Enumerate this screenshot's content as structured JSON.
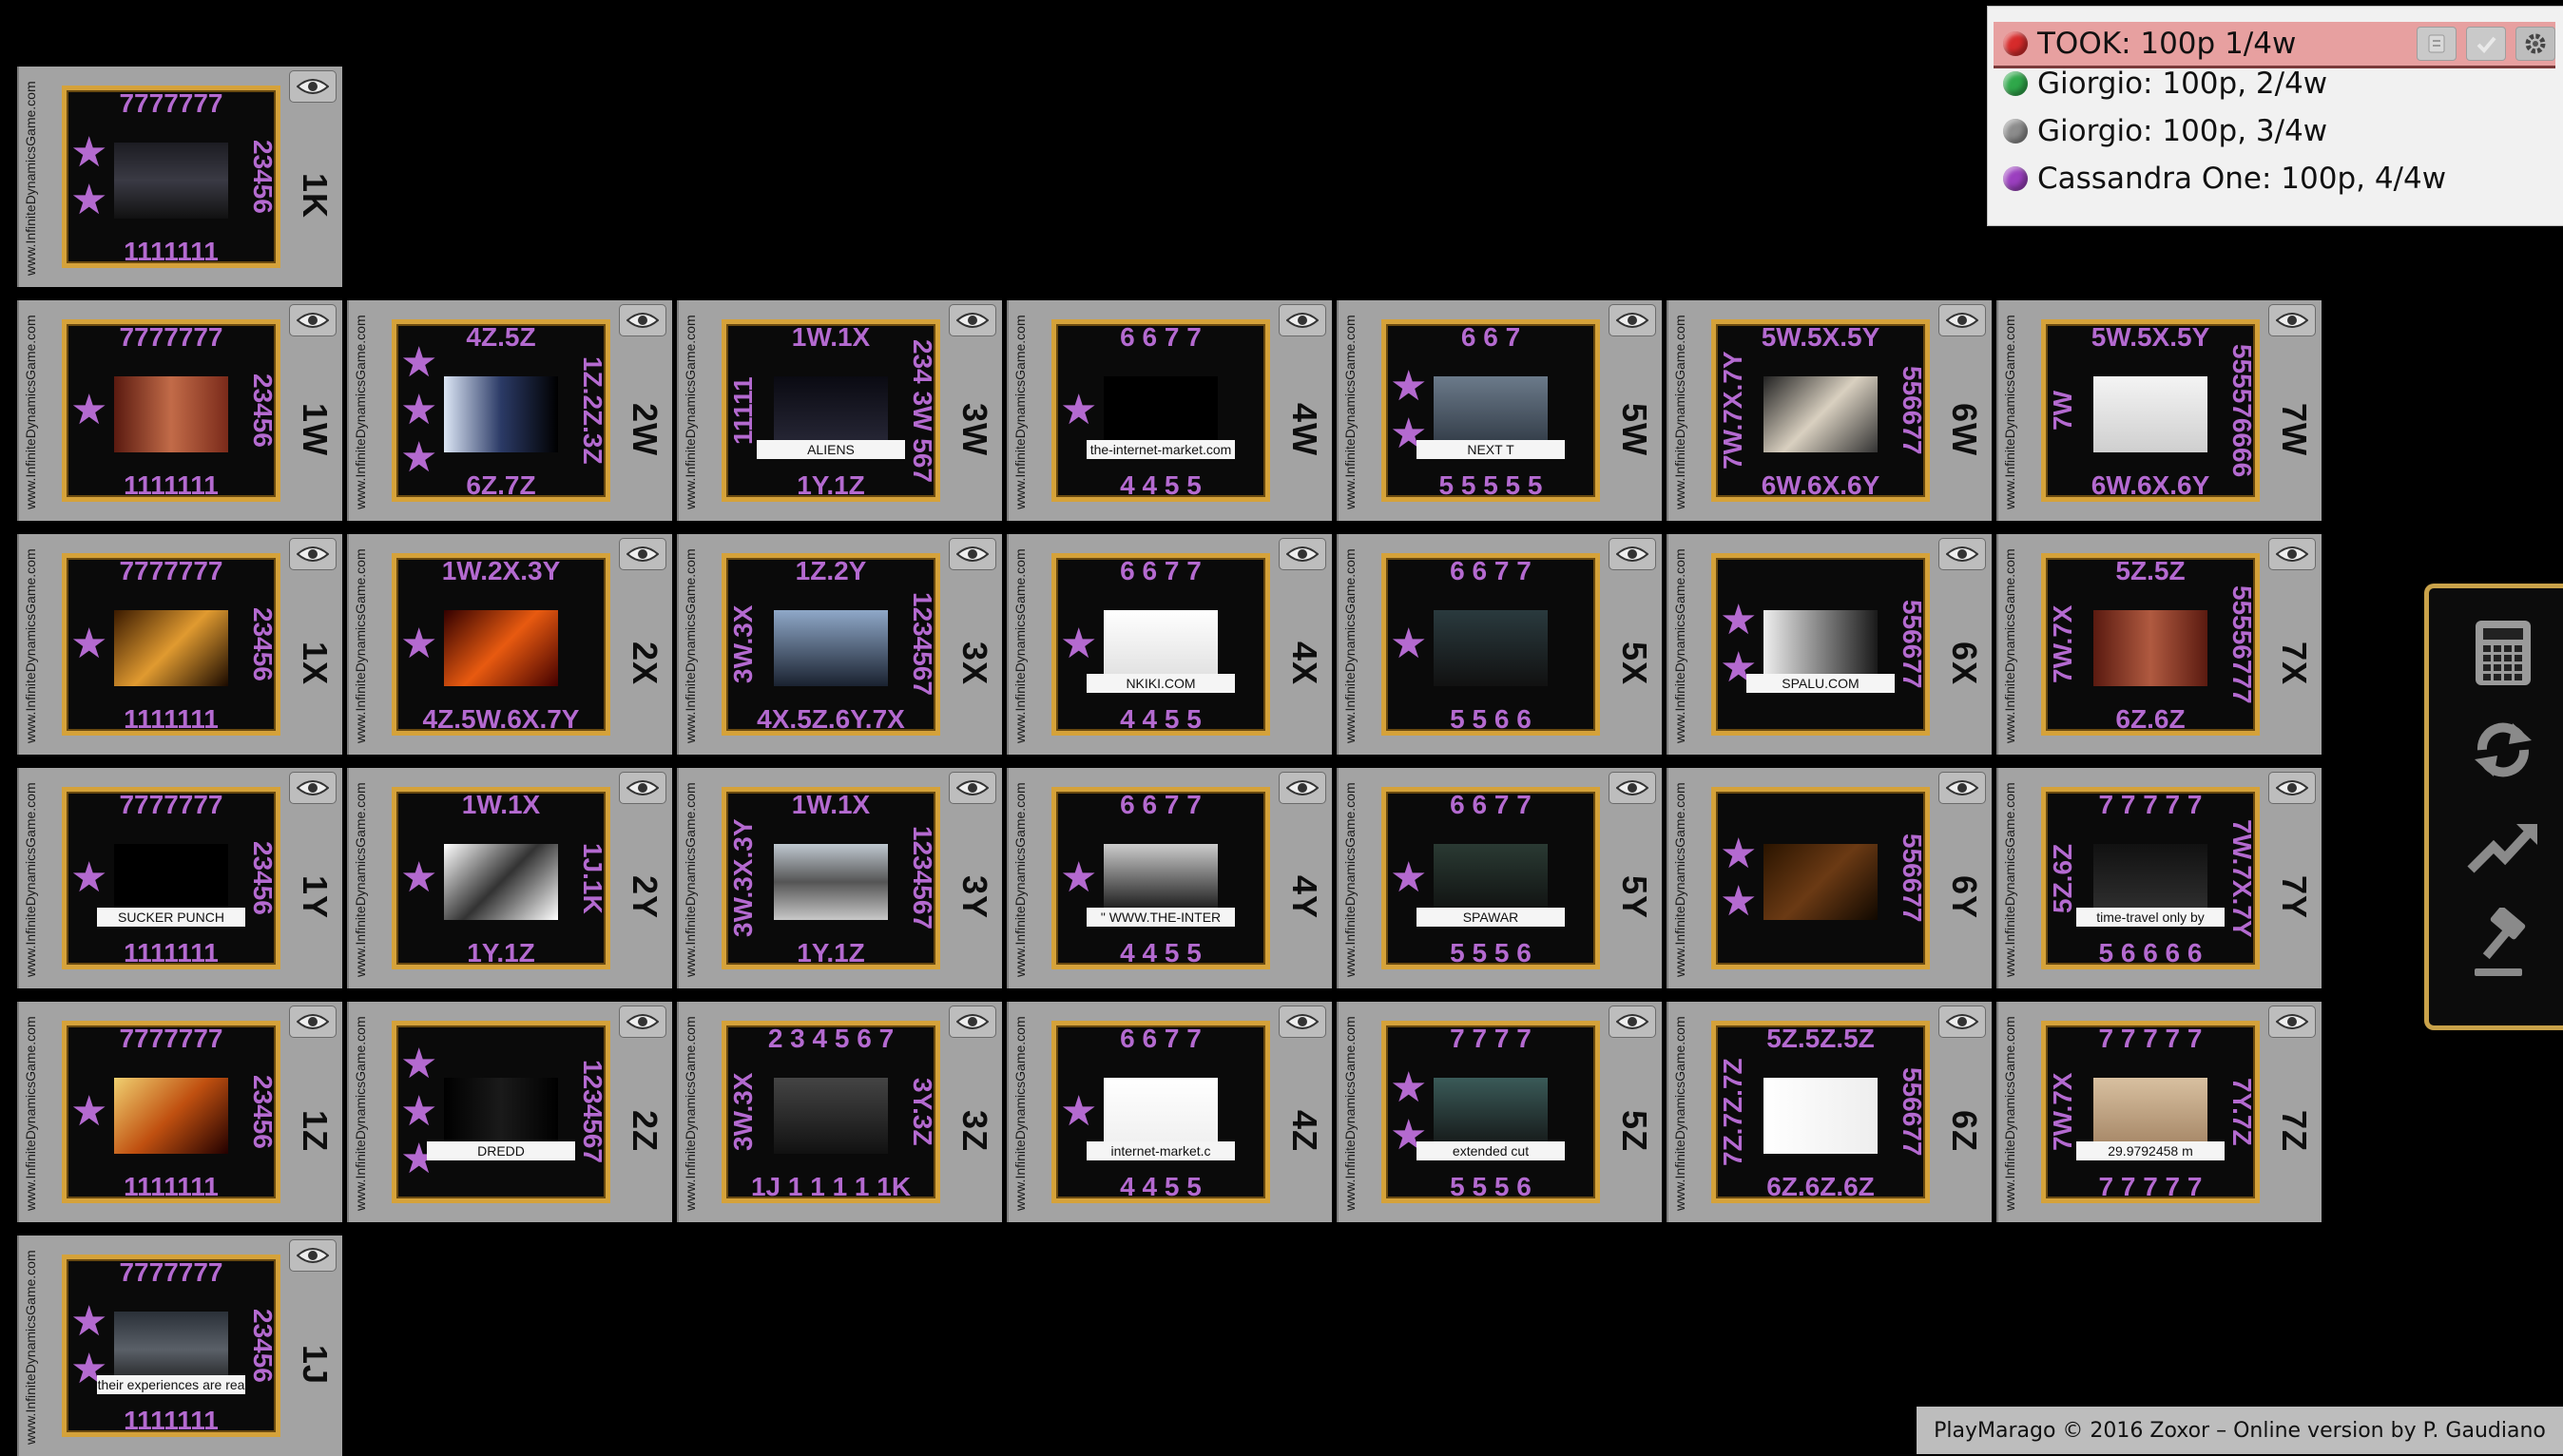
{
  "players": [
    {
      "label": "TOOK: 100p 1/4w",
      "color": "#d62b2b",
      "active": true
    },
    {
      "label": "Giorgio: 100p, 2/4w",
      "color": "#2fa84a",
      "active": false
    },
    {
      "label": "Giorgio: 100p, 3/4w",
      "color": "#8c8c8c",
      "active": false
    },
    {
      "label": "Cassandra One: 100p, 4/4w",
      "color": "#9b3fbf",
      "active": false
    }
  ],
  "player_buttons": [
    "list-icon",
    "check-icon",
    "gear-icon"
  ],
  "website": "www.InfiniteDynamicsGame.com",
  "cards": {
    "r0c0": {
      "code": "1K",
      "top": "7777777",
      "bottom": "1111111",
      "right": "23456",
      "left": "",
      "stars": 2
    },
    "r1c0": {
      "code": "1W",
      "top": "7777777",
      "bottom": "1111111",
      "right": "23456",
      "left": "",
      "stars": 1
    },
    "r1c1": {
      "code": "2W",
      "top": "4Z.5Z",
      "bottom": "6Z.7Z",
      "right": "1Z.2Z.3Z",
      "left": "",
      "stars": 3
    },
    "r1c2": {
      "code": "3W",
      "top": "1W.1X",
      "bottom": "1Y.1Z",
      "right": "234 3W 567",
      "left": "11111",
      "stars": 0,
      "text": "ALIENS"
    },
    "r1c3": {
      "code": "4W",
      "top": "6 6 7 7",
      "bottom": "4 4 5 5",
      "right": "",
      "left": "",
      "stars": 1,
      "text": "the-internet-market.com"
    },
    "r1c4": {
      "code": "5W",
      "top": "6 6 7",
      "bottom": "5 5 5 5 5",
      "right": "",
      "left": "",
      "stars": 2,
      "text": "NEXT T"
    },
    "r1c5": {
      "code": "6W",
      "top": "5W.5X.5Y",
      "bottom": "6W.6X.6Y",
      "right": "556677",
      "left": "7W.7X.7Y",
      "stars": 0
    },
    "r1c6": {
      "code": "7W",
      "top": "5W.5X.5Y",
      "bottom": "6W.6X.6Y",
      "right": "555576666",
      "left": "7W",
      "stars": 0
    },
    "r2c0": {
      "code": "1X",
      "top": "7777777",
      "bottom": "1111111",
      "right": "23456",
      "left": "",
      "stars": 1
    },
    "r2c1": {
      "code": "2X",
      "top": "1W.2X.3Y",
      "bottom": "4Z.5W.6X.7Y",
      "right": "",
      "left": "",
      "stars": 1
    },
    "r2c2": {
      "code": "3X",
      "top": "1Z.2Y",
      "bottom": "4X.5Z.6Y.7X",
      "right": "1234567",
      "left": "3W.3X",
      "stars": 0
    },
    "r2c3": {
      "code": "4X",
      "top": "6 6 7 7",
      "bottom": "4 4 5 5",
      "right": "",
      "left": "",
      "stars": 1,
      "text": "NKIKI.COM"
    },
    "r2c4": {
      "code": "5X",
      "top": "6 6 7 7",
      "bottom": "5 5 6 6",
      "right": "",
      "left": "",
      "stars": 1
    },
    "r2c5": {
      "code": "6X",
      "top": "",
      "bottom": "",
      "right": "556677",
      "left": "",
      "stars": 2,
      "text": "SPALU.COM"
    },
    "r2c6": {
      "code": "7X",
      "top": "5Z.5Z",
      "bottom": "6Z.6Z",
      "right": "55556777",
      "left": "7W.7X",
      "stars": 0
    },
    "r3c0": {
      "code": "1Y",
      "top": "7777777",
      "bottom": "1111111",
      "right": "23456",
      "left": "",
      "stars": 1,
      "text": "SUCKER PUNCH"
    },
    "r3c1": {
      "code": "2Y",
      "top": "1W.1X",
      "bottom": "1Y.1Z",
      "right": "1J.1K",
      "left": "",
      "stars": 1
    },
    "r3c2": {
      "code": "3Y",
      "top": "1W.1X",
      "bottom": "1Y.1Z",
      "right": "1234567",
      "left": "3W.3X.3Y",
      "stars": 0
    },
    "r3c3": {
      "code": "4Y",
      "top": "6 6 7 7",
      "bottom": "4 4 5 5",
      "right": "",
      "left": "",
      "stars": 1,
      "text": "\" WWW.THE-INTER"
    },
    "r3c4": {
      "code": "5Y",
      "top": "6 6 7 7",
      "bottom": "5 5 5 6",
      "right": "",
      "left": "",
      "stars": 1,
      "text": "SPAWAR"
    },
    "r3c5": {
      "code": "6Y",
      "top": "",
      "bottom": "",
      "right": "556677",
      "left": "",
      "stars": 2
    },
    "r3c6": {
      "code": "7Y",
      "top": "7 7 7 7 7",
      "bottom": "5 6 6 6 6",
      "right": "7W.7X.7Y",
      "left": "5Z.6Z",
      "stars": 0,
      "text": "time-travel only by"
    },
    "r4c0": {
      "code": "1Z",
      "top": "7777777",
      "bottom": "1111111",
      "right": "23456",
      "left": "",
      "stars": 1
    },
    "r4c1": {
      "code": "2Z",
      "top": "",
      "bottom": "",
      "right": "1234567",
      "left": "",
      "stars": 3,
      "text": "DREDD"
    },
    "r4c2": {
      "code": "3Z",
      "top": "2 3 4 5 6 7",
      "bottom": "1J 1 1 1 1 1K",
      "right": "3Y.3Z",
      "left": "3W.3X",
      "stars": 0
    },
    "r4c3": {
      "code": "4Z",
      "top": "6 6 7 7",
      "bottom": "4 4 5 5",
      "right": "",
      "left": "",
      "stars": 1,
      "text": "internet-market.c"
    },
    "r4c4": {
      "code": "5Z",
      "top": "7 7 7 7",
      "bottom": "5 5 5 6",
      "right": "",
      "left": "",
      "stars": 2,
      "text": "extended cut"
    },
    "r4c5": {
      "code": "6Z",
      "top": "5Z.5Z.5Z",
      "bottom": "6Z.6Z.6Z",
      "right": "556677",
      "left": "7Z.7Z.7Z",
      "stars": 0
    },
    "r4c6": {
      "code": "7Z",
      "top": "7 7 7 7 7",
      "bottom": "7 7 7 7 7",
      "right": "7Y.7Z",
      "left": "7W.7X",
      "stars": 0,
      "text": "29.9792458 m"
    },
    "r5c0": {
      "code": "1J",
      "top": "7777777",
      "bottom": "1111111",
      "right": "23456",
      "left": "",
      "stars": 2,
      "text": "their experiences are rea"
    }
  },
  "sidebar": [
    "calculator-icon",
    "refresh-icon",
    "trend-up-icon",
    "gavel-icon"
  ],
  "footer": "PlayMarago © 2016 Zoxor – Online version by P. Gaudiano",
  "colors": {
    "card_frame": "#d5a23a",
    "label_purple": "#b46ad0",
    "tile_grey": "#a3a3a3"
  }
}
